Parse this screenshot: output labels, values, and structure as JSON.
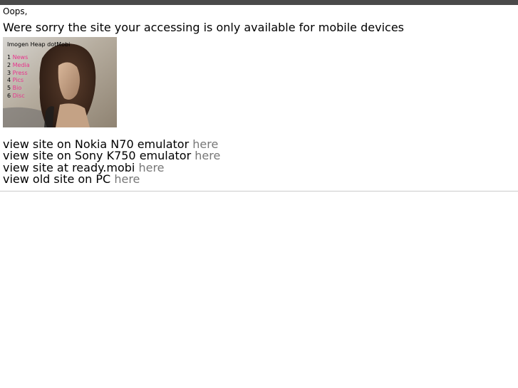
{
  "page": {
    "greeting": "Oops,",
    "headline": "Were sorry the site your accessing is only available for mobile devices"
  },
  "phone_preview": {
    "title": "Imogen Heap dotMobi",
    "menu": [
      {
        "num": "1",
        "label": "News"
      },
      {
        "num": "2",
        "label": "Media"
      },
      {
        "num": "3",
        "label": "Press"
      },
      {
        "num": "4",
        "label": "Pics"
      },
      {
        "num": "5",
        "label": "Bio"
      },
      {
        "num": "6",
        "label": "Disc"
      }
    ],
    "menu_color": "#e8348c"
  },
  "links": [
    {
      "prefix": "view site on Nokia N70 emulator",
      "link": "here"
    },
    {
      "prefix": "view site on Sony K750 emulator",
      "link": "here"
    },
    {
      "prefix": "view site at ready.mobi",
      "link": "here"
    },
    {
      "prefix": "view old site on PC",
      "link": "here"
    }
  ],
  "colors": {
    "top_bar": "#4a4a4a",
    "link": "#777777",
    "divider": "#cccccc"
  }
}
